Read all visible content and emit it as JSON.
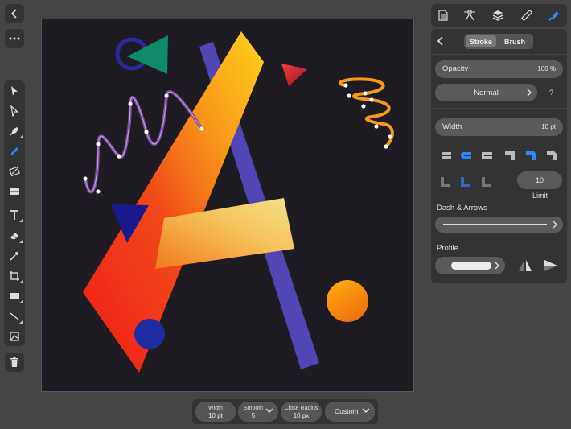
{
  "left_toolbar": {
    "tools": [
      "move-tool",
      "node-tool",
      "pen-tool",
      "pencil-tool",
      "vector-brush-tool",
      "fill-tool",
      "text-tool",
      "eraser-tool",
      "color-picker-tool",
      "crop-tool",
      "rectangle-tool",
      "line-tool",
      "place-image-tool"
    ]
  },
  "context_bar": {
    "width_label": "Width",
    "width_value": "10 pt",
    "smooth_label": "Smooth",
    "smooth_value": "5",
    "close_radius_label": "Close Radius",
    "close_radius_value": "10 px",
    "custom_label": "Custom"
  },
  "stroke_panel": {
    "tab_stroke": "Stroke",
    "tab_brush": "Brush",
    "opacity_label": "Opacity",
    "opacity_value": "100 %",
    "blend_mode": "Normal",
    "help": "?",
    "width_label": "Width",
    "width_value": "10 pt",
    "miter_value": "10",
    "limit_label": "Limit",
    "dash_label": "Dash & Arrows",
    "profile_label": "Profile"
  },
  "colors": {
    "accent": "#2e86ff",
    "panel": "#333333",
    "background": "#444444",
    "canvas": "#1e1b22"
  }
}
